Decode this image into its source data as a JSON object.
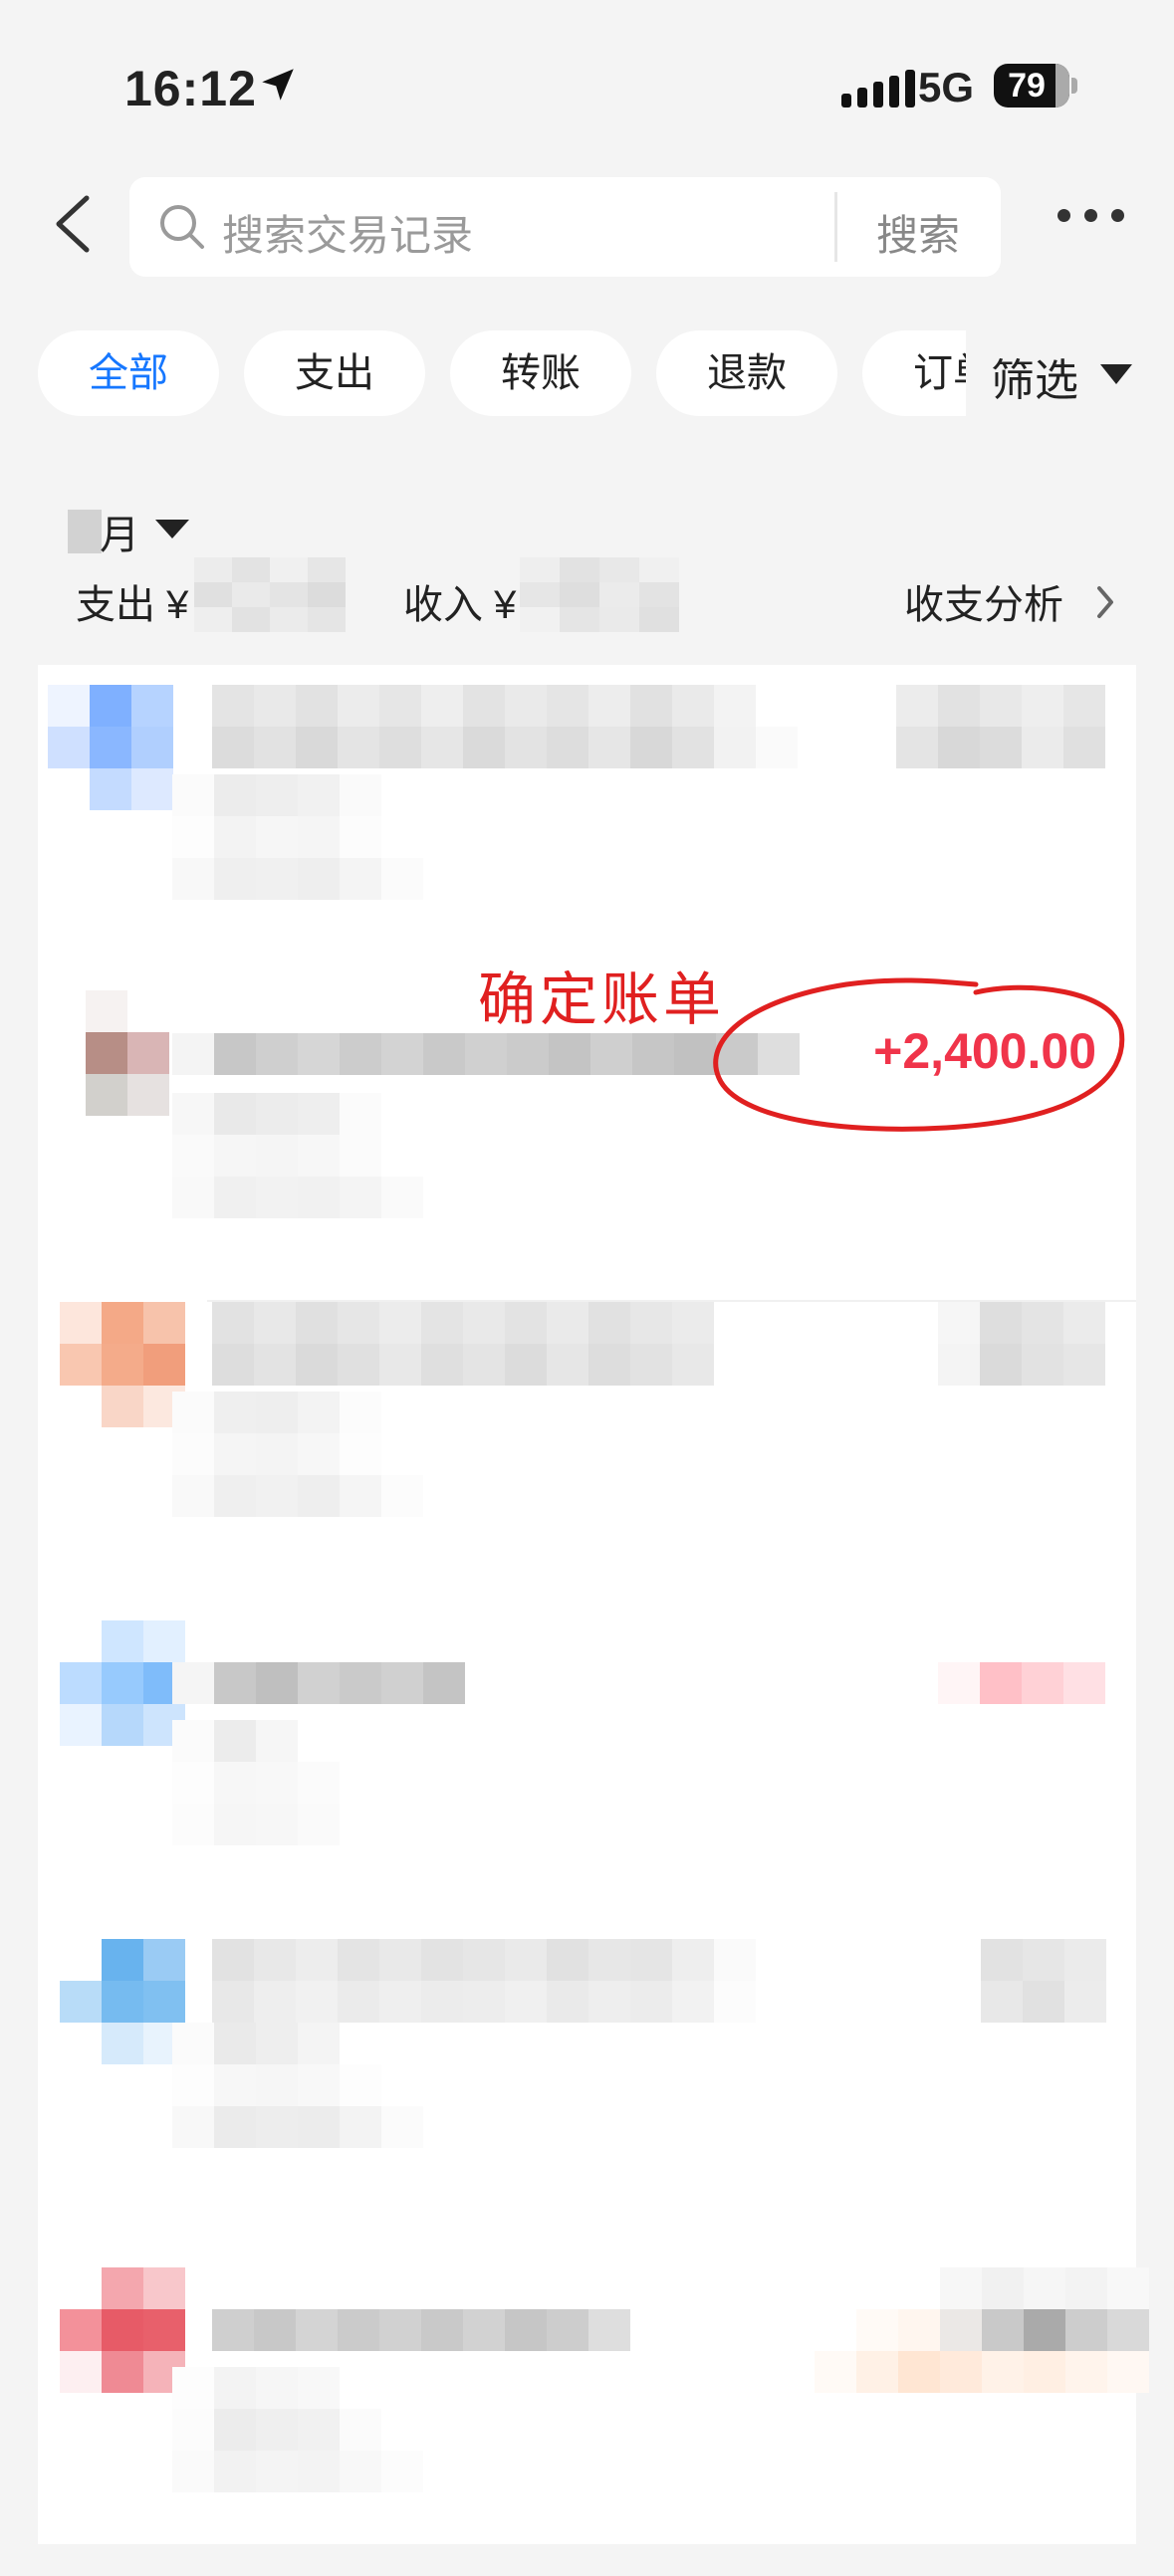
{
  "status_bar": {
    "time": "16:12",
    "network": "5G",
    "battery": "79"
  },
  "header": {
    "search_placeholder": "搜索交易记录",
    "search_button": "搜索"
  },
  "filters": {
    "chips": [
      {
        "label": "全部",
        "active": true
      },
      {
        "label": "支出",
        "active": false
      },
      {
        "label": "转账",
        "active": false
      },
      {
        "label": "退款",
        "active": false
      },
      {
        "label": "订单",
        "active": false
      }
    ],
    "filter_label": "筛选"
  },
  "summary": {
    "month_label": "月",
    "expense_label": "支出 ¥",
    "income_label": "收入 ¥",
    "analysis_label": "收支分析"
  },
  "transactions": {
    "highlighted_amount": "+2,400.00",
    "annotation": "确定账单"
  },
  "colors": {
    "accent": "#1677ff",
    "income_amount": "#f0344a",
    "annotation_red": "#e02020"
  }
}
